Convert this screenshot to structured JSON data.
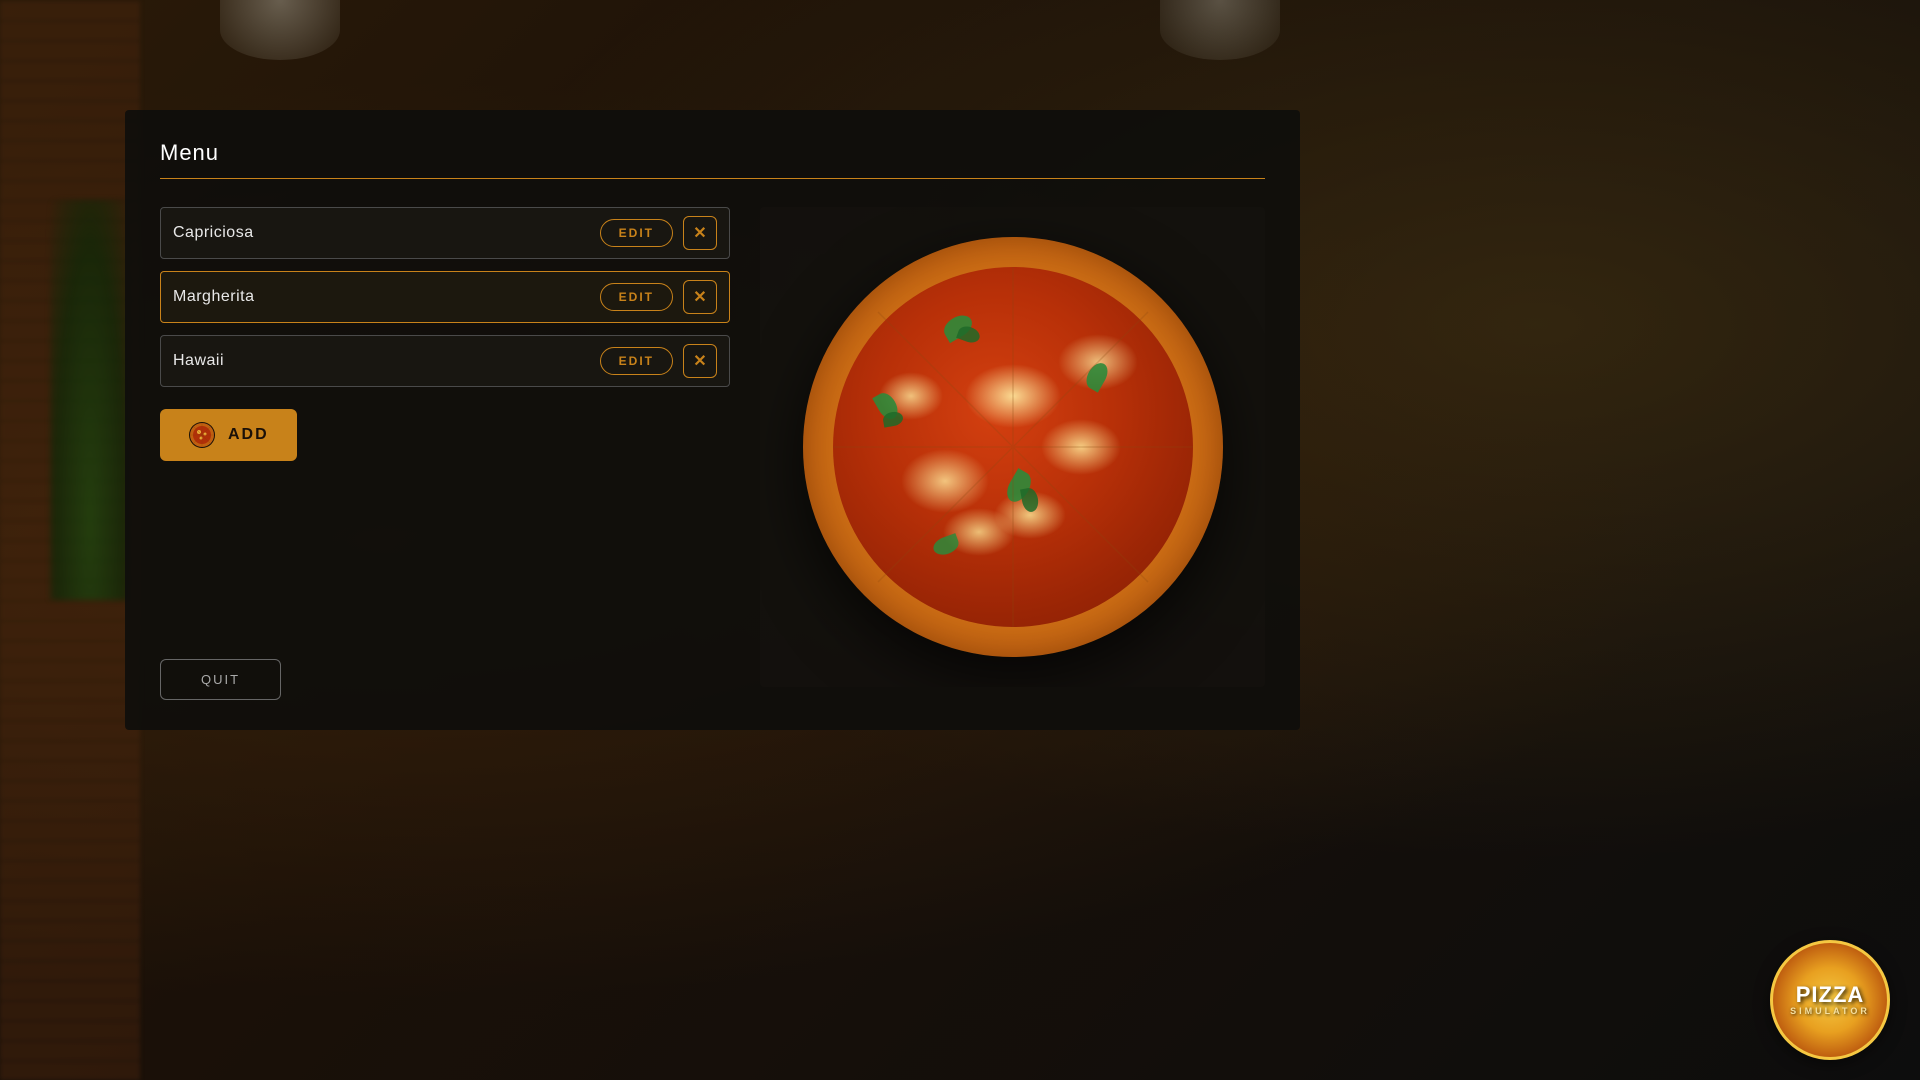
{
  "app": {
    "title": "Pizza Simulator",
    "logo_text": "PIZZA",
    "logo_subtext": "SIMULATOR"
  },
  "panel": {
    "title": "Menu",
    "menu_items": [
      {
        "id": "capriciosa",
        "name": "Capriciosa",
        "selected": false
      },
      {
        "id": "margherita",
        "name": "Margherita",
        "selected": true
      },
      {
        "id": "hawaii",
        "name": "Hawaii",
        "selected": false
      }
    ],
    "edit_label": "EDIT",
    "add_label": "ADD",
    "quit_label": "QUIT"
  },
  "colors": {
    "accent": "#c8821a",
    "panel_bg": "rgba(15,14,12,0.93)",
    "selected_border": "#c8821a"
  }
}
